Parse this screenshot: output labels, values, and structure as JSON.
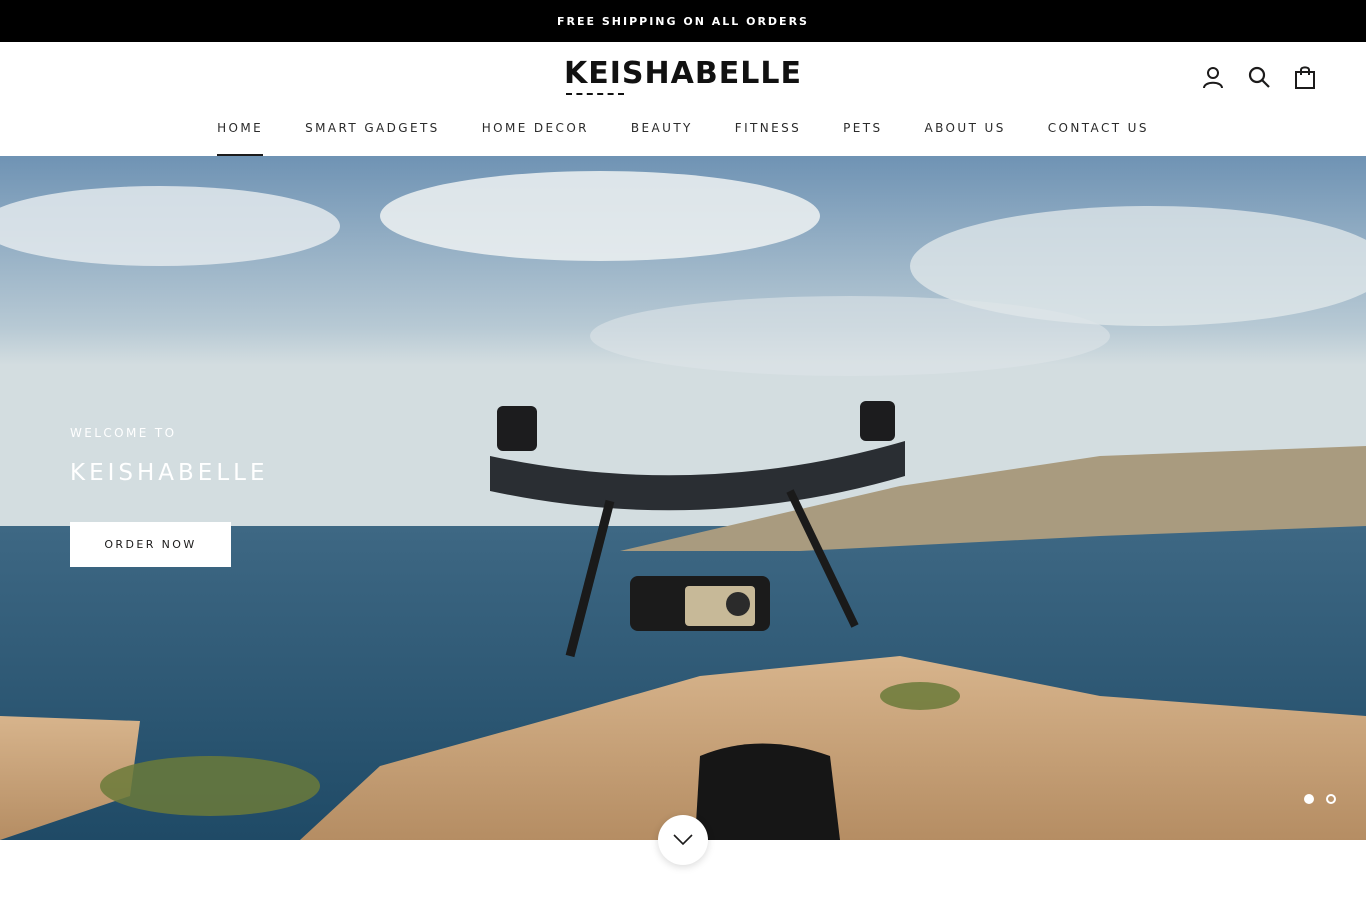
{
  "announcement": {
    "text": "FREE SHIPPING ON ALL ORDERS"
  },
  "header": {
    "logo": "KEISHABELLE",
    "icons": [
      "account-icon",
      "search-icon",
      "cart-icon"
    ]
  },
  "nav": {
    "items": [
      {
        "label": "HOME",
        "active": true
      },
      {
        "label": "SMART GADGETS"
      },
      {
        "label": "HOME DECOR"
      },
      {
        "label": "BEAUTY"
      },
      {
        "label": "FITNESS"
      },
      {
        "label": "PETS"
      },
      {
        "label": "ABOUT US"
      },
      {
        "label": "CONTACT US"
      }
    ]
  },
  "hero": {
    "subtitle": "WELCOME TO",
    "title": "KEISHABELLE",
    "button": "ORDER NOW",
    "slides": 2,
    "active_slide": 1
  },
  "scroll_icon": "chevron-down-icon",
  "colors": {
    "announcement_bg": "#000000",
    "text": "#1c1b1b",
    "button_bg": "#ffffff"
  }
}
